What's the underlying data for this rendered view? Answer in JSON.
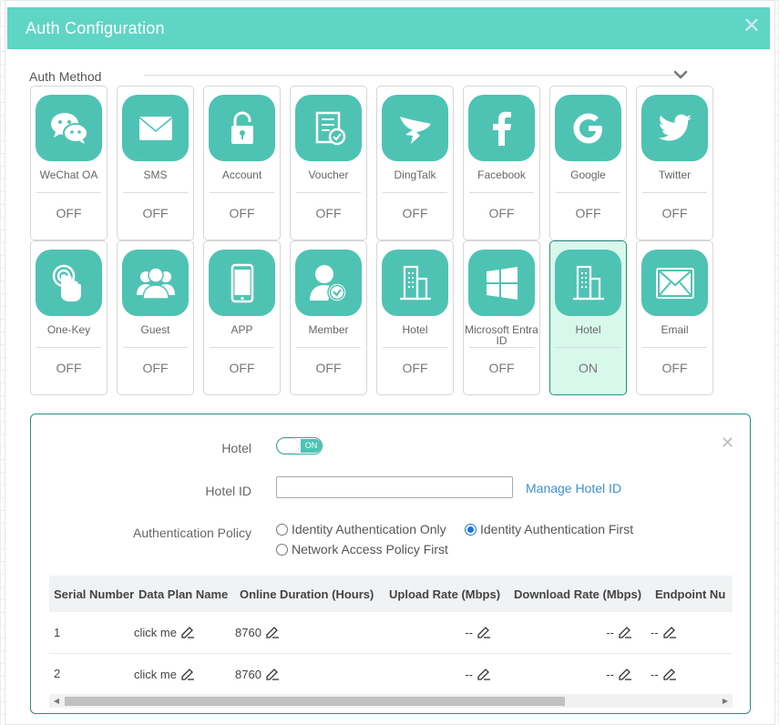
{
  "dialog": {
    "title": "Auth Configuration",
    "close_icon": "close-icon"
  },
  "auth_method": {
    "label": "Auth Method",
    "tiles": [
      {
        "label": "WeChat OA",
        "status": "OFF",
        "icon": "wechat-icon"
      },
      {
        "label": "SMS",
        "status": "OFF",
        "icon": "envelope-icon"
      },
      {
        "label": "Account",
        "status": "OFF",
        "icon": "lock-icon"
      },
      {
        "label": "Voucher",
        "status": "OFF",
        "icon": "voucher-icon"
      },
      {
        "label": "DingTalk",
        "status": "OFF",
        "icon": "dingtalk-icon"
      },
      {
        "label": "Facebook",
        "status": "OFF",
        "icon": "facebook-icon"
      },
      {
        "label": "Google",
        "status": "OFF",
        "icon": "google-icon"
      },
      {
        "label": "Twitter",
        "status": "OFF",
        "icon": "twitter-icon"
      },
      {
        "label": "One-Key",
        "status": "OFF",
        "icon": "touch-icon"
      },
      {
        "label": "Guest",
        "status": "OFF",
        "icon": "guests-icon"
      },
      {
        "label": "APP",
        "status": "OFF",
        "icon": "phone-icon"
      },
      {
        "label": "Member",
        "status": "OFF",
        "icon": "member-icon"
      },
      {
        "label": "Hotel",
        "status": "OFF",
        "icon": "building-icon"
      },
      {
        "label": "Microsoft Entra ID",
        "status": "OFF",
        "icon": "windows-icon"
      },
      {
        "label": "Hotel",
        "status": "ON",
        "icon": "building-icon",
        "active": true
      },
      {
        "label": "Email",
        "status": "OFF",
        "icon": "mail-icon"
      }
    ]
  },
  "hotel_panel": {
    "hotel_label": "Hotel",
    "toggle_text": "ON",
    "hotel_id_label": "Hotel ID",
    "hotel_id_value": "",
    "manage_link": "Manage Hotel ID",
    "policy_label": "Authentication Policy",
    "policy_options": [
      {
        "label": "Identity Authentication Only",
        "selected": false
      },
      {
        "label": "Identity Authentication First",
        "selected": true
      },
      {
        "label": "Network Access Policy First",
        "selected": false
      }
    ],
    "table": {
      "headers": [
        "Serial Number",
        "Data Plan Name",
        "Online Duration (Hours)",
        "Upload Rate (Mbps)",
        "Download Rate (Mbps)",
        "Endpoint Nu"
      ],
      "rows": [
        {
          "serial": "1",
          "plan": "click me",
          "duration": "8760",
          "upload": "--",
          "download": "--",
          "endpoint": "--"
        },
        {
          "serial": "2",
          "plan": "click me",
          "duration": "8760",
          "upload": "--",
          "download": "--",
          "endpoint": "--"
        }
      ]
    },
    "scrollbar": {
      "left_arrow": "◀",
      "right_arrow": "▶"
    }
  },
  "colors": {
    "accent": "#5fd5c6",
    "icon_bg": "#4fc3b3",
    "active_tile_bg": "#d9f8ec",
    "link": "#3b8fd6"
  }
}
